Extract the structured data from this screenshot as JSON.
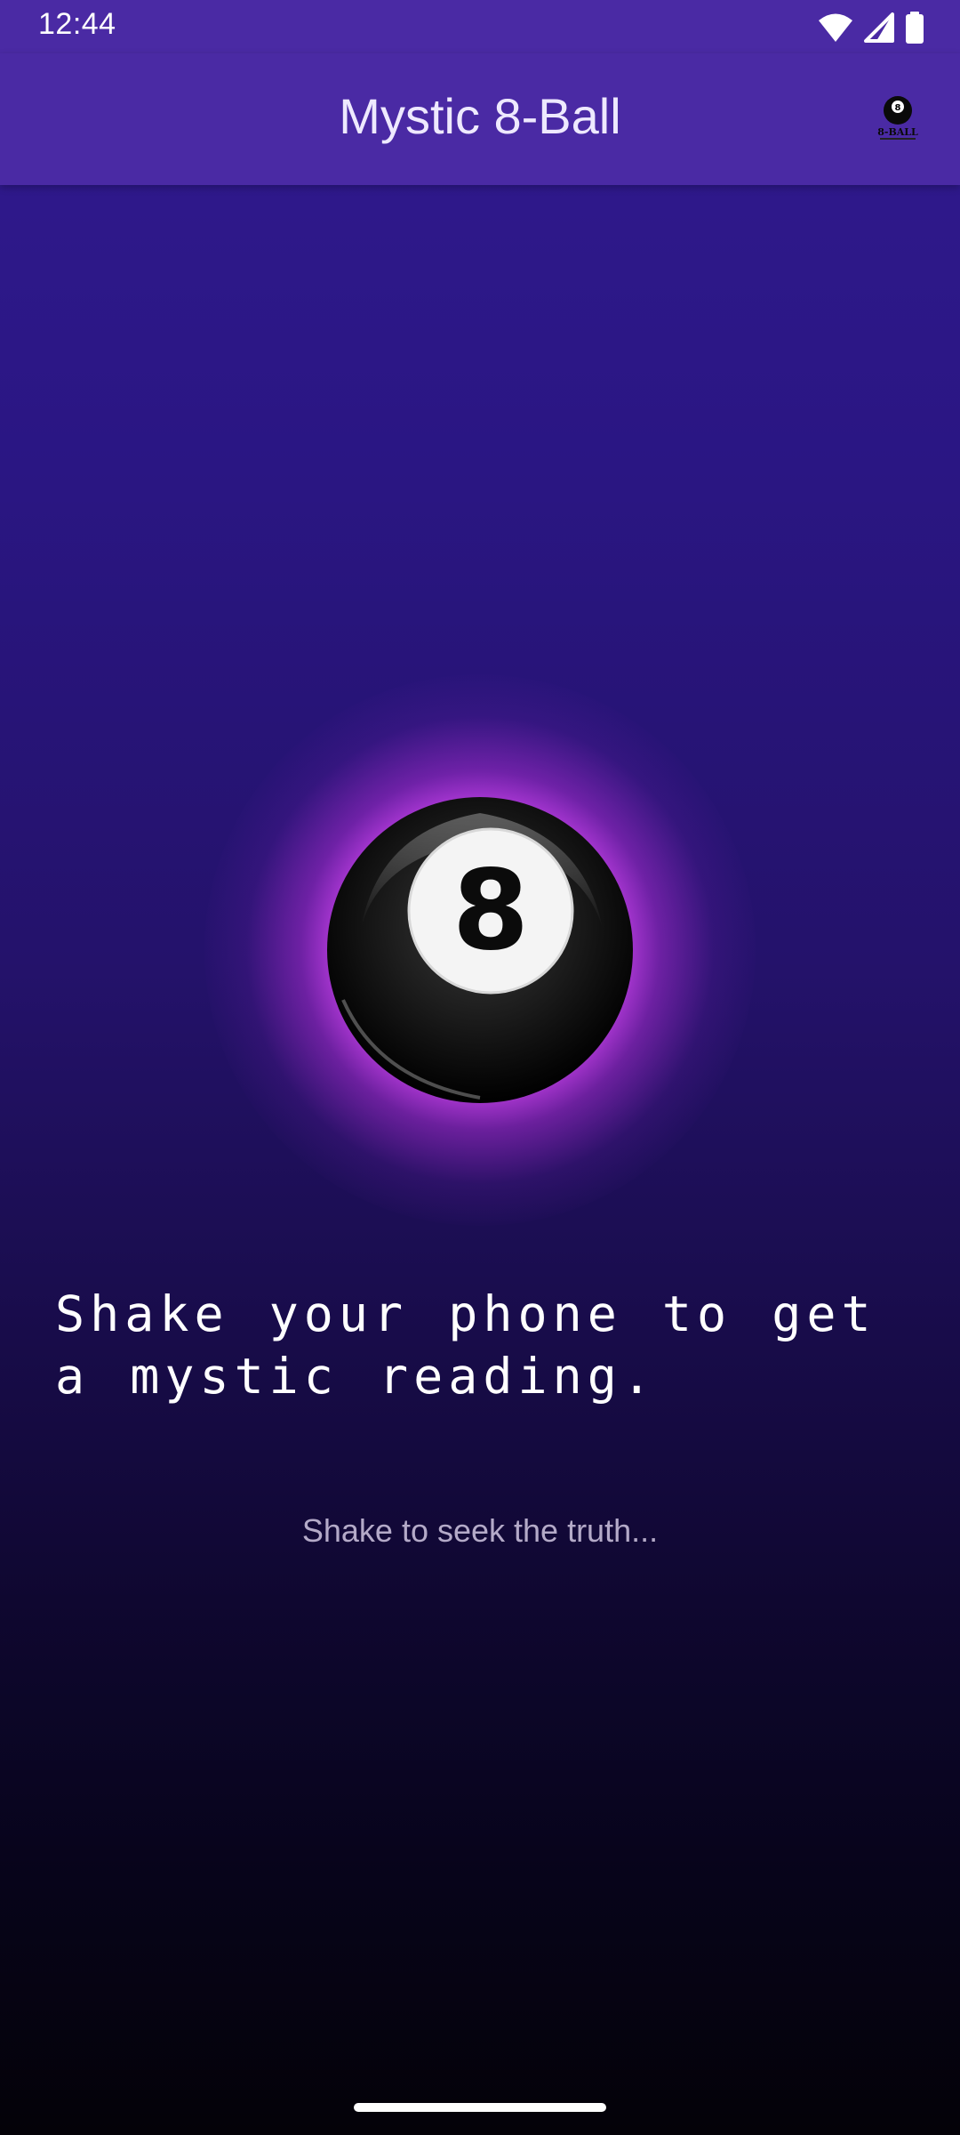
{
  "status_bar": {
    "time": "12:44",
    "icons": [
      "wifi-icon",
      "cellular-signal-icon",
      "battery-icon"
    ]
  },
  "app_bar": {
    "title": "Mystic 8-Ball",
    "logo_icon": "eight-ball-logo-icon",
    "logo_text": "8-BALL"
  },
  "main": {
    "ball_number": "8",
    "reading_text": "Shake your phone to get a mystic reading.",
    "hint_text": "Shake to seek the truth..."
  },
  "colors": {
    "app_bar": "#4a2aa4",
    "background_top": "#311a8f",
    "background_bottom": "#040208",
    "glow": "#e050ff",
    "ball": "#111111"
  }
}
